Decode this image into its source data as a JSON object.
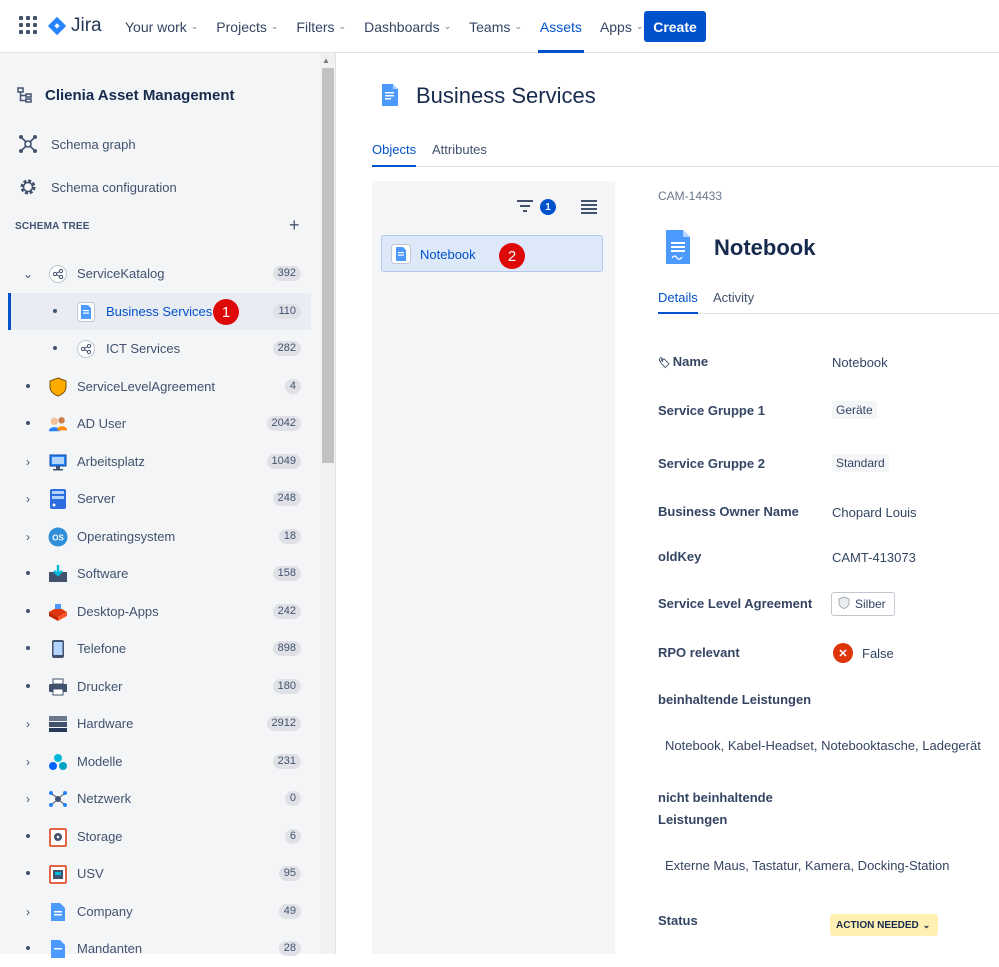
{
  "topnav": {
    "logo_text": "Jira",
    "items": [
      {
        "label": "Your work",
        "chevron": true
      },
      {
        "label": "Projects",
        "chevron": true
      },
      {
        "label": "Filters",
        "chevron": true
      },
      {
        "label": "Dashboards",
        "chevron": true
      },
      {
        "label": "Teams",
        "chevron": true
      },
      {
        "label": "Assets",
        "chevron": false,
        "active": true
      },
      {
        "label": "Apps",
        "chevron": true
      }
    ],
    "create_label": "Create"
  },
  "sidebar": {
    "project_title": "Clienia Asset Management",
    "links": [
      {
        "label": "Schema graph",
        "icon": "schema-graph-icon"
      },
      {
        "label": "Schema configuration",
        "icon": "gear-icon"
      }
    ],
    "section_title": "SCHEMA TREE",
    "tree": [
      {
        "label": "ServiceKatalog",
        "count": "392",
        "toggle": "v",
        "icon": "share-icon"
      },
      {
        "label": "Business Services",
        "count": "110",
        "toggle": "•",
        "icon": "document-icon",
        "child": true,
        "selected": true
      },
      {
        "label": "ICT Services",
        "count": "282",
        "toggle": "•",
        "icon": "share-icon",
        "child": true
      },
      {
        "label": "ServiceLevelAgreement",
        "count": "4",
        "toggle": "•",
        "icon": "shield-icon"
      },
      {
        "label": "AD User",
        "count": "2042",
        "toggle": "•",
        "icon": "users-icon"
      },
      {
        "label": "Arbeitsplatz",
        "count": "1049",
        "toggle": ">",
        "icon": "monitor-icon"
      },
      {
        "label": "Server",
        "count": "248",
        "toggle": ">",
        "icon": "server-icon"
      },
      {
        "label": "Operatingsystem",
        "count": "18",
        "toggle": ">",
        "icon": "os-icon"
      },
      {
        "label": "Software",
        "count": "158",
        "toggle": "•",
        "icon": "software-icon"
      },
      {
        "label": "Desktop-Apps",
        "count": "242",
        "toggle": "•",
        "icon": "desktop-apps-icon"
      },
      {
        "label": "Telefone",
        "count": "898",
        "toggle": "•",
        "icon": "phone-icon"
      },
      {
        "label": "Drucker",
        "count": "180",
        "toggle": "•",
        "icon": "printer-icon"
      },
      {
        "label": "Hardware",
        "count": "2912",
        "toggle": ">",
        "icon": "hardware-icon"
      },
      {
        "label": "Modelle",
        "count": "231",
        "toggle": ">",
        "icon": "models-icon"
      },
      {
        "label": "Netzwerk",
        "count": "0",
        "toggle": ">",
        "icon": "network-icon"
      },
      {
        "label": "Storage",
        "count": "6",
        "toggle": "•",
        "icon": "storage-icon"
      },
      {
        "label": "USV",
        "count": "95",
        "toggle": "•",
        "icon": "usv-icon"
      },
      {
        "label": "Company",
        "count": "49",
        "toggle": ">",
        "icon": "company-icon"
      },
      {
        "label": "Mandanten",
        "count": "28",
        "toggle": "•",
        "icon": "mandanten-icon"
      }
    ],
    "annotation_1": "1"
  },
  "main": {
    "title": "Business Services",
    "tabs": [
      "Objects",
      "Attributes"
    ],
    "filter_count": "1",
    "object_card_label": "Notebook",
    "annotation_2": "2"
  },
  "detail": {
    "key": "CAM-14433",
    "title": "Notebook",
    "tabs": [
      "Details",
      "Activity"
    ],
    "attributes": {
      "name_label": "Name",
      "name_value": "Notebook",
      "gruppe1_label": "Service Gruppe 1",
      "gruppe1_value": "Geräte",
      "gruppe2_label": "Service Gruppe 2",
      "gruppe2_value": "Standard",
      "owner_label": "Business Owner Name",
      "owner_value": "Chopard Louis",
      "oldkey_label": "oldKey",
      "oldkey_value": "CAMT-413073",
      "sla_label": "Service Level Agreement",
      "sla_value": "Silber",
      "rpo_label": "RPO relevant",
      "rpo_value": "False",
      "incl_label": "beinhaltende Leistungen",
      "incl_value": "Notebook, Kabel-Headset, Notebooktasche, Ladegerät",
      "notincl_label_1": "nicht beinhaltende",
      "notincl_label_2": "Leistungen",
      "notincl_value": "Externe Maus, Tastatur, Kamera, Docking-Station",
      "status_label": "Status",
      "status_value": "ACTION NEEDED"
    }
  },
  "colors": {
    "accent": "#0052cc",
    "annotation_red": "#de0a0a",
    "status_yellow": "#fff0b3",
    "false_red": "#de350b"
  }
}
